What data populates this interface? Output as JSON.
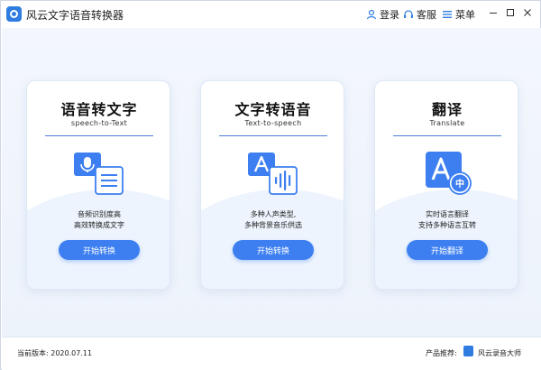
{
  "app": {
    "title": "风云文字语音转换器"
  },
  "titlebar": {
    "login_label": "登录",
    "service_label": "客服",
    "menu_label": "菜单"
  },
  "cards": [
    {
      "title": "语音转文字",
      "subtitle": "speech-to-Text",
      "icon": "microphone-document-icon",
      "desc_line1": "音频识别度高",
      "desc_line2": "高效转换成文字",
      "button_label": "开始转换"
    },
    {
      "title": "文字转语音",
      "subtitle": "Text-to-speech",
      "icon": "text-audio-wave-icon",
      "desc_line1": "多种人声类型,",
      "desc_line2": "多种背景音乐供选",
      "button_label": "开始转换"
    },
    {
      "title": "翻译",
      "subtitle": "Translate",
      "icon": "translate-icon",
      "desc_line1": "实时语言翻译",
      "desc_line2": "支持多种语言互转",
      "button_label": "开始翻译"
    }
  ],
  "statusbar": {
    "version_text": "当前版本: 2020.07.11",
    "recommend_label": "产品推荐:",
    "recommend_product": "风云录音大师"
  },
  "colors": {
    "accent": "#3d7ff0",
    "brand": "#2f7de1",
    "background": "#edf3fb"
  }
}
